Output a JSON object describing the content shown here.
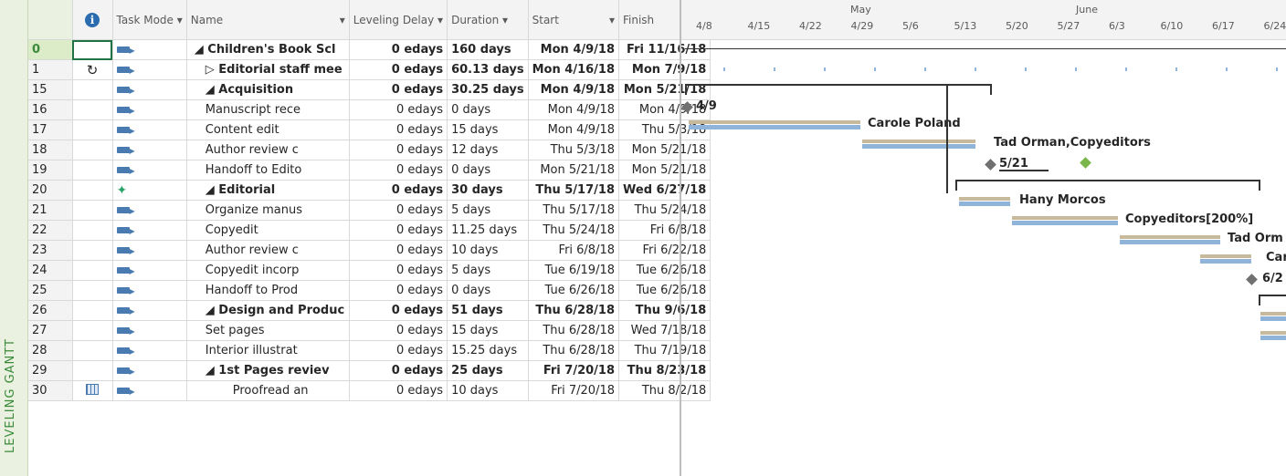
{
  "side_label": "LEVELING GANTT",
  "columns": {
    "id": "",
    "indicator": "i",
    "mode": "Task Mode",
    "name": "Name",
    "delay": "Leveling Delay",
    "duration": "Duration",
    "start": "Start",
    "finish": "Finish"
  },
  "rows": [
    {
      "id": "0",
      "ind": "",
      "name": "◢ Children's Book Scl",
      "delay": "0 edays",
      "dur": "160 days",
      "start": "Mon 4/9/18",
      "finish": "Fri 11/16/18",
      "bold": true,
      "indent": 0
    },
    {
      "id": "1",
      "ind": "recurring",
      "name": "▷ Editorial staff mee",
      "delay": "0 edays",
      "dur": "60.13 days",
      "start": "Mon 4/16/18",
      "finish": "Mon 7/9/18",
      "bold": true,
      "indent": 1
    },
    {
      "id": "15",
      "ind": "",
      "name": "◢ Acquisition",
      "delay": "0 edays",
      "dur": "30.25 days",
      "start": "Mon 4/9/18",
      "finish": "Mon 5/21/18",
      "bold": true,
      "indent": 1
    },
    {
      "id": "16",
      "ind": "",
      "name": "Manuscript rece",
      "delay": "0 edays",
      "dur": "0 days",
      "start": "Mon 4/9/18",
      "finish": "Mon 4/9/18",
      "bold": false,
      "indent": 2
    },
    {
      "id": "17",
      "ind": "",
      "name": "Content edit",
      "delay": "0 edays",
      "dur": "15 days",
      "start": "Mon 4/9/18",
      "finish": "Thu 5/3/18",
      "bold": false,
      "indent": 2
    },
    {
      "id": "18",
      "ind": "",
      "name": "Author review c",
      "delay": "0 edays",
      "dur": "12 days",
      "start": "Thu 5/3/18",
      "finish": "Mon 5/21/18",
      "bold": false,
      "indent": 2
    },
    {
      "id": "19",
      "ind": "",
      "name": "Handoff to Edito",
      "delay": "0 edays",
      "dur": "0 days",
      "start": "Mon 5/21/18",
      "finish": "Mon 5/21/18",
      "bold": false,
      "indent": 2
    },
    {
      "id": "20",
      "ind": "",
      "name": "◢ Editorial",
      "delay": "0 edays",
      "dur": "30 days",
      "start": "Thu 5/17/18",
      "finish": "Wed 6/27/18",
      "bold": true,
      "indent": 1
    },
    {
      "id": "21",
      "ind": "",
      "name": "Organize manus",
      "delay": "0 edays",
      "dur": "5 days",
      "start": "Thu 5/17/18",
      "finish": "Thu 5/24/18",
      "bold": false,
      "indent": 2
    },
    {
      "id": "22",
      "ind": "",
      "name": "Copyedit",
      "delay": "0 edays",
      "dur": "11.25 days",
      "start": "Thu 5/24/18",
      "finish": "Fri 6/8/18",
      "bold": false,
      "indent": 2
    },
    {
      "id": "23",
      "ind": "",
      "name": "Author review c",
      "delay": "0 edays",
      "dur": "10 days",
      "start": "Fri 6/8/18",
      "finish": "Fri 6/22/18",
      "bold": false,
      "indent": 2
    },
    {
      "id": "24",
      "ind": "",
      "name": "Copyedit incorp",
      "delay": "0 edays",
      "dur": "5 days",
      "start": "Tue 6/19/18",
      "finish": "Tue 6/26/18",
      "bold": false,
      "indent": 2
    },
    {
      "id": "25",
      "ind": "",
      "name": "Handoff to Prod",
      "delay": "0 edays",
      "dur": "0 days",
      "start": "Tue 6/26/18",
      "finish": "Tue 6/26/18",
      "bold": false,
      "indent": 2
    },
    {
      "id": "26",
      "ind": "",
      "name": "◢ Design and Produc",
      "delay": "0 edays",
      "dur": "51 days",
      "start": "Thu 6/28/18",
      "finish": "Thu 9/6/18",
      "bold": true,
      "indent": 1
    },
    {
      "id": "27",
      "ind": "",
      "name": "Set pages",
      "delay": "0 edays",
      "dur": "15 days",
      "start": "Thu 6/28/18",
      "finish": "Wed 7/18/18",
      "bold": false,
      "indent": 2
    },
    {
      "id": "28",
      "ind": "",
      "name": "Interior illustrat",
      "delay": "0 edays",
      "dur": "15.25 days",
      "start": "Thu 6/28/18",
      "finish": "Thu 7/19/18",
      "bold": false,
      "indent": 2
    },
    {
      "id": "29",
      "ind": "",
      "name": "◢ 1st Pages reviev",
      "delay": "0 edays",
      "dur": "25 days",
      "start": "Fri 7/20/18",
      "finish": "Thu 8/23/18",
      "bold": true,
      "indent": 2
    },
    {
      "id": "30",
      "ind": "calendar",
      "name": "Proofread an",
      "delay": "0 edays",
      "dur": "10 days",
      "start": "Fri 7/20/18",
      "finish": "Thu 8/2/18",
      "bold": false,
      "indent": 3
    }
  ],
  "timescale": {
    "months": [
      "May",
      "June"
    ],
    "ticks": [
      "4/8",
      "4/15",
      "4/22",
      "4/29",
      "5/6",
      "5/13",
      "5/20",
      "5/27",
      "6/3",
      "6/10",
      "6/17",
      "6/24"
    ]
  },
  "bar_labels": {
    "r16": "4/9",
    "r17": "Carole Poland",
    "r18": "Tad Orman,Copyeditors",
    "r19": "5/21",
    "r21": "Hany Morcos",
    "r22": "Copyeditors[200%]",
    "r23": "Tad Orm",
    "r24": "Car",
    "r25": "6/2"
  },
  "colors": {
    "accent": "#217346",
    "baseline": "#c6b99c",
    "task": "#8fb3d9"
  }
}
